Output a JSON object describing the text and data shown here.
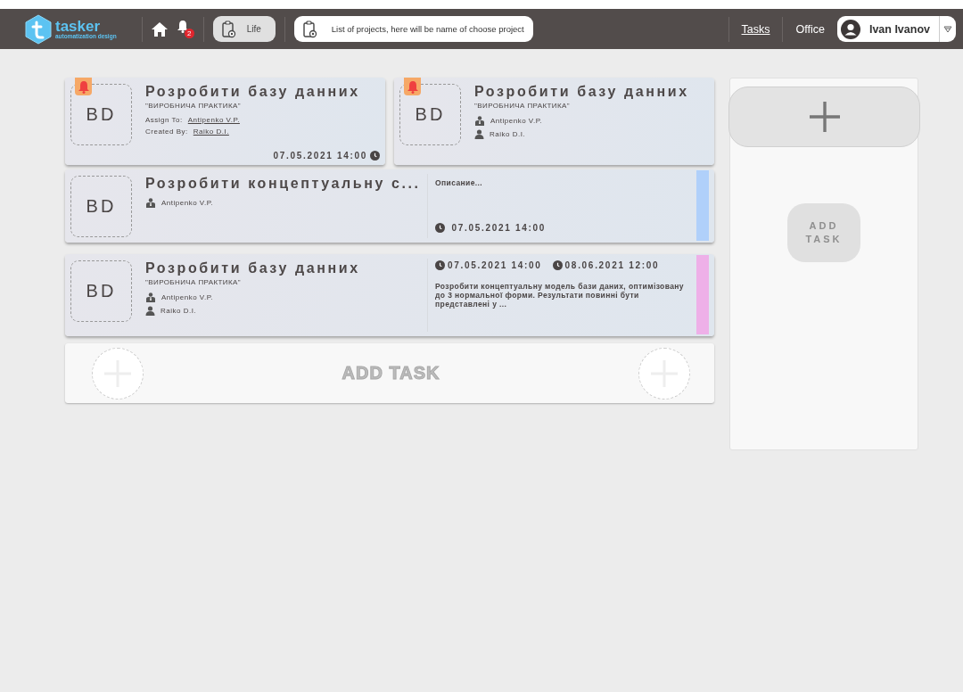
{
  "header": {
    "logo": {
      "name": "tasker",
      "tagline": "automatization design"
    },
    "notifications": "2",
    "workspace": "Life",
    "project_placeholder": "List of projects, here will be name of choose project",
    "nav": [
      {
        "label": "Tasks",
        "selected": true
      },
      {
        "label": "Office",
        "selected": false
      }
    ],
    "user": "Ivan Ivanov"
  },
  "tasks": [
    {
      "kind": "compact",
      "badge": "BD",
      "alert": true,
      "title": "Розробити базу данних",
      "project": "\"ВИРОБНИЧА ПРАКТИКА\"",
      "people": [
        {
          "kind": "text",
          "label": "Assign To:",
          "name": "Antipenko V.P."
        },
        {
          "kind": "text",
          "label": "Created By:",
          "name": "Raiko D.I."
        }
      ],
      "dates": [
        "07.05.2021 14:00"
      ]
    },
    {
      "kind": "compact",
      "badge": "BD",
      "alert": true,
      "title": "Розробити базу данних",
      "project": "\"ВИРОБНИЧА ПРАКТИКА\"",
      "people": [
        {
          "kind": "boss",
          "name": "Antipenko V.P."
        },
        {
          "kind": "user",
          "name": "Raiko D.I."
        }
      ]
    },
    {
      "kind": "wide",
      "badge": "BD",
      "alert": false,
      "title": "Розробити концептуальну с...",
      "people": [
        {
          "kind": "boss",
          "name": "Antipenko V.P."
        }
      ],
      "description": "Описание...",
      "dates": [
        "07.05.2021 14:00"
      ],
      "color": "#b0d0fa"
    },
    {
      "kind": "wide",
      "badge": "BD",
      "alert": false,
      "title": "Розробити базу данних",
      "project": "\"ВИРОБНИЧА ПРАКТИКА\"",
      "people": [
        {
          "kind": "boss",
          "name": "Antipenko V.P."
        },
        {
          "kind": "user",
          "name": "Raiko D.I."
        }
      ],
      "description": "Розробити концептуальну модель бази даних, оптимізовану до 3 нормальної форми. Результати повинні бути представлені у ...",
      "dates": [
        "07.05.2021 14:00",
        "08.06.2021 12:00"
      ],
      "color": "#eeb0e8"
    }
  ],
  "add_task_bar": {
    "label": "ADD TASK"
  },
  "side_panel": {
    "add_label": "ADD TASK"
  }
}
